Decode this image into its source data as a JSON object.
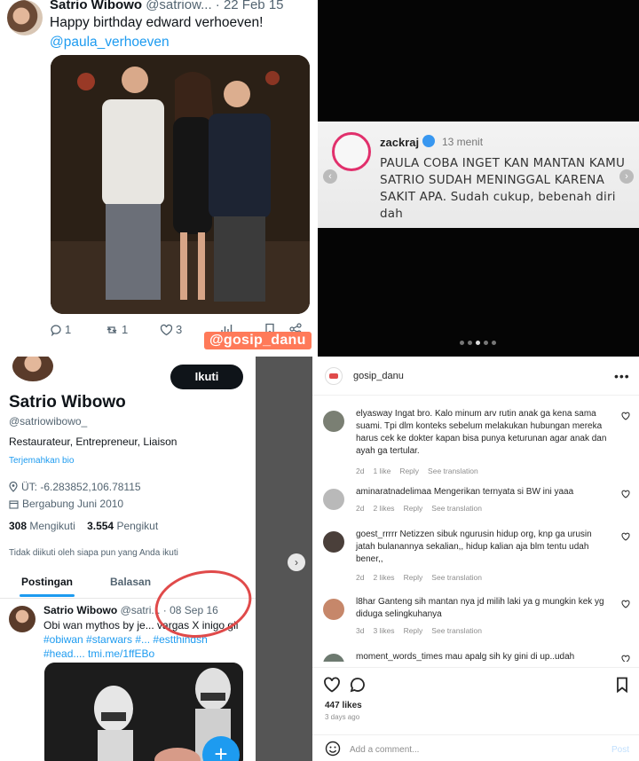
{
  "tweet": {
    "name": "Satrio Wibowo",
    "handle_meta": "@satriow... · 22 Feb 15",
    "text": "Happy birthday edward verhoeven!",
    "mention": "@paula_verhoeven",
    "replies": "1",
    "retweets": "1",
    "likes": "3",
    "watermark": "@gosip_danu"
  },
  "comment_card": {
    "username": "zackraj",
    "time": "13 menit",
    "text": "PAULA COBA INGET KAN MANTAN KAMU SATRIO SUDAH MENINGGAL KARENA SAKIT APA. Sudah cukup, bebenah diri dah"
  },
  "profile": {
    "follow_label": "Ikuti",
    "name": "Satrio Wibowo",
    "handle": "@satriowibowo_",
    "bio": "Restaurateur, Entrepreneur, Liaison",
    "translate": "Terjemahkan bio",
    "location": "ÜT: -6.283852,106.78115",
    "joined": "Bergabung Juni 2010",
    "following_count": "308",
    "following_label": "Mengikuti",
    "followers_count": "3.554",
    "followers_label": "Pengikut",
    "not_followed": "Tidak diikuti oleh siapa pun yang Anda ikuti",
    "tabs": [
      "Postingan",
      "Balasan"
    ],
    "tweet_name": "Satrio Wibowo",
    "tweet_meta": "@satri... · 08 Sep 16",
    "tweet_line1": "Obi wan mythos by je... vargas X inigo gil",
    "tweet_line2": "#obiwan #starwars #... #estthindsh",
    "tweet_line3": "#head.... tmi.me/1ffEBo"
  },
  "instagram": {
    "account": "gosip_danu",
    "comments": [
      {
        "user": "elyasway",
        "text": "Ingat bro. Kalo minum arv rutin anak ga kena sama suami. Tpi dlm konteks sebelum melakukan hubungan mereka harus cek ke dokter kapan bisa punya keturunan agar anak dan ayah ga tertular.",
        "age": "2d",
        "likes": "1 like",
        "reply": "Reply",
        "translate": "See translation"
      },
      {
        "user": "aminaratnadelimaa",
        "text": "Mengerikan ternyata si BW ini yaaa",
        "age": "2d",
        "likes": "2 likes",
        "reply": "Reply",
        "translate": "See translation"
      },
      {
        "user": "goest_rrrrr",
        "text": "Netizzen sibuk ngurusin hidup org, knp ga urusin jatah bulanannya sekalian,, hidup kalian aja blm tentu udah bener,,",
        "age": "2d",
        "likes": "2 likes",
        "reply": "Reply",
        "translate": "See translation"
      },
      {
        "user": "l8har",
        "text": "Ganteng sih mantan nya jd milih laki ya g mungkin kek yg diduga selingkuhanya",
        "age": "3d",
        "likes": "3 likes",
        "reply": "Reply",
        "translate": "See translation"
      },
      {
        "user": "moment_words_times",
        "text": "mau apalg sih ky gini di up..udah",
        "age": "",
        "likes": "",
        "reply": "",
        "translate": ""
      }
    ],
    "likes_total": "447 likes",
    "posted_ago": "3 days ago",
    "add_comment_placeholder": "Add a comment...",
    "post_label": "Post"
  }
}
